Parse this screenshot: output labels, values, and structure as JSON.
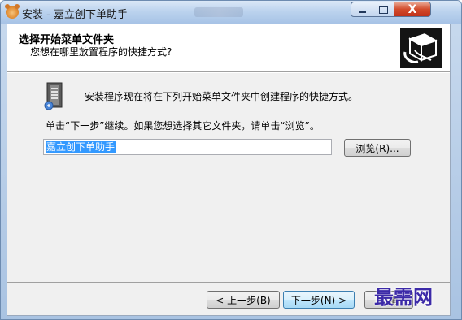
{
  "window": {
    "title": "安装 - 嘉立创下单助手",
    "controls": {
      "minimize_icon": "minimize-icon",
      "maximize_icon": "maximize-icon",
      "close_glyph": "X"
    }
  },
  "header": {
    "title": "选择开始菜单文件夹",
    "subtitle": "您想在哪里放置程序的快捷方式?",
    "image_icon": "installer-box-icon"
  },
  "body": {
    "folder_icon": "start-menu-folder-icon",
    "info_text": "安装程序现在将在下列开始菜单文件夹中创建程序的快捷方式。",
    "instruction_text": "单击“下一步”继续。如果您想选择其它文件夹，请单击“浏览”。",
    "folder_input_value": "嘉立创下单助手",
    "browse_label": "浏览(R)..."
  },
  "footer": {
    "back_label": "< 上一步(B)",
    "next_label": "下一步(N) >",
    "cancel_label": "取消"
  },
  "watermark": "最需网",
  "colors": {
    "selection": "#3399ff",
    "dialog_bg": "#f0f0f0",
    "header_bg": "#ffffff",
    "close_button": "#c7412a",
    "watermark": "#3c2aa8"
  }
}
